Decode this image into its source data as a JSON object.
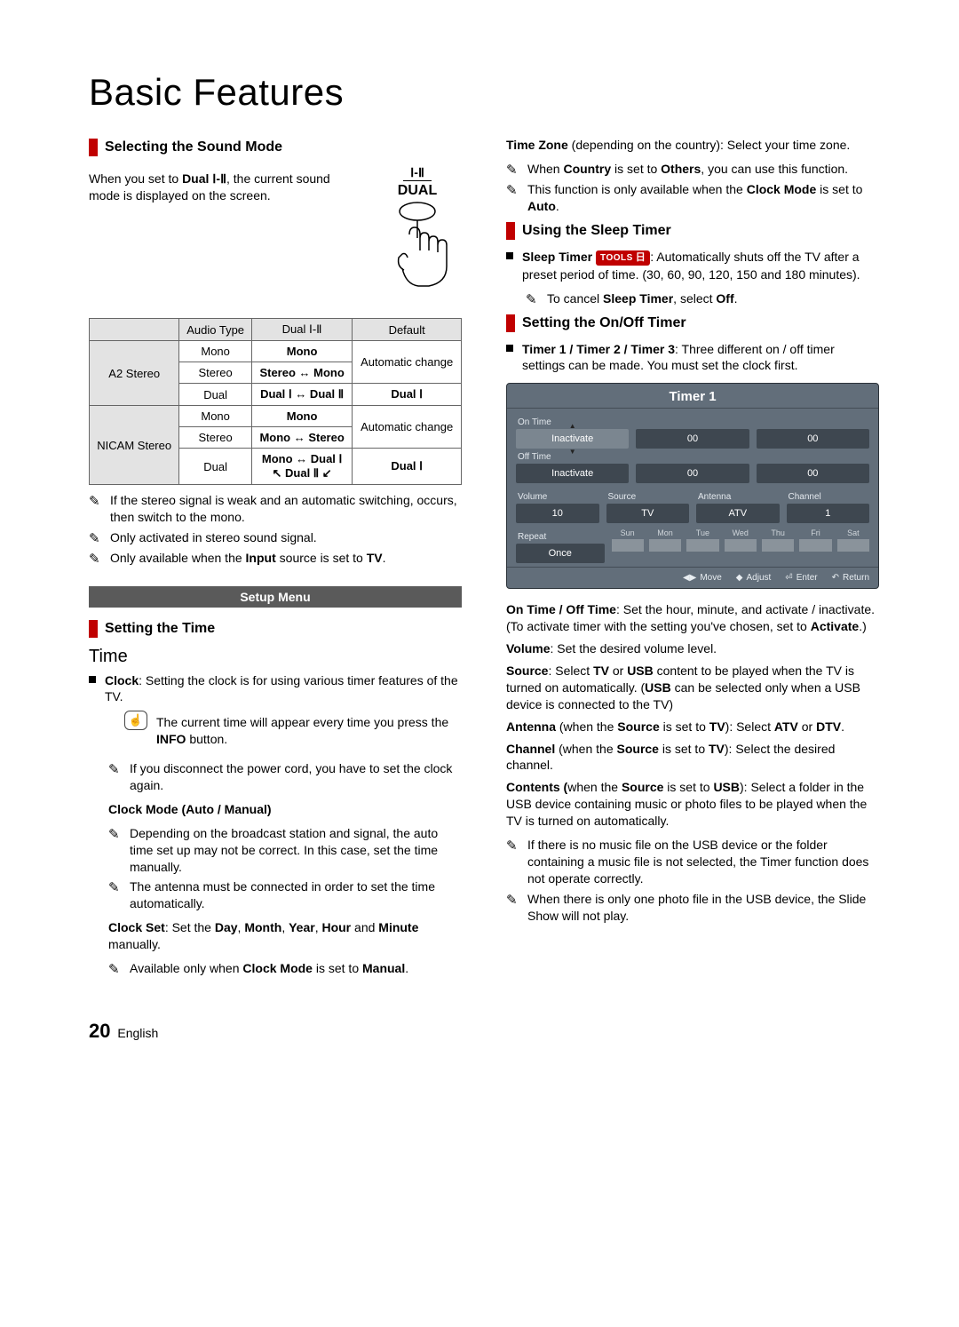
{
  "title": "Basic Features",
  "footer": {
    "pageNumber": "20",
    "lang": "English"
  },
  "leftCol": {
    "soundMode": {
      "heading": "Selecting the Sound Mode",
      "intro_before": "When you set to ",
      "intro_bold": "Dual Ⅰ-Ⅱ",
      "intro_after": ", the current sound mode is displayed on the screen.",
      "dualFig": {
        "line1": "Ⅰ-Ⅱ",
        "line2": "DUAL"
      },
      "table": {
        "headers": {
          "c1": "",
          "c2": "Audio Type",
          "c3": "Dual Ⅰ-Ⅱ",
          "c4": "Default"
        },
        "groups": [
          {
            "group": "A2 Stereo",
            "rows": [
              {
                "type": "Mono",
                "dual": "Mono",
                "default": "Automatic change",
                "dualBold": true
              },
              {
                "type": "Stereo",
                "dual": "Stereo ↔ Mono",
                "default": "",
                "dualBold": true
              },
              {
                "type": "Dual",
                "dual": "Dual Ⅰ ↔ Dual Ⅱ",
                "default": "Dual Ⅰ",
                "dualBold": true
              }
            ]
          },
          {
            "group": "NICAM Stereo",
            "rows": [
              {
                "type": "Mono",
                "dual": "Mono",
                "default": "Automatic change",
                "dualBold": true
              },
              {
                "type": "Stereo",
                "dual": "Mono ↔ Stereo",
                "default": "",
                "dualBold": true
              },
              {
                "type": "Dual",
                "dual": "Mono ↔ Dual Ⅰ\n↖ Dual Ⅱ ↙",
                "default": "Dual Ⅰ",
                "dualBold": true
              }
            ]
          }
        ]
      },
      "notes": [
        "If the stereo signal is weak and an automatic switching, occurs, then switch to the mono.",
        "Only activated in stereo sound signal.",
        {
          "pre": "Only available when the ",
          "b": "Input",
          "post": " source is set to ",
          "b2": "TV",
          "post2": "."
        }
      ]
    },
    "setupBand": "Setup Menu",
    "settingTime": {
      "heading": "Setting the Time"
    },
    "time": {
      "bigHeading": "Time",
      "clock": {
        "label": "Clock",
        "text": ": Setting the clock is for using various timer features of the TV.",
        "infoNote_before": "The current time will appear every time you press the ",
        "infoNote_bold": "INFO",
        "infoNote_after": " button.",
        "disconnectNote": "If you disconnect the power cord, you have to set the clock again.",
        "clockModeLabel": "Clock Mode (Auto / Manual)",
        "clockModeNotes": [
          "Depending on the broadcast station and signal, the auto time set up may not be correct. In this case, set the time manually.",
          "The antenna must be connected in order to set the time automatically."
        ],
        "clockSet_before": "Clock Set",
        "clockSet_after1": ": Set the ",
        "words": [
          "Day",
          "Month",
          "Year",
          "Hour",
          "Minute"
        ],
        "clockSet_tail": " manually.",
        "clockSetNote_before": "Available only when ",
        "clockSetNote_bold": "Clock Mode",
        "clockSetNote_mid": " is set to ",
        "clockSetNote_bold2": "Manual",
        "clockSetNote_after": "."
      }
    }
  },
  "rightCol": {
    "timeZone": {
      "lead_before": "Time Zone",
      "lead_after": " (depending on the country): Select your time zone.",
      "notes": [
        {
          "pre": "When ",
          "b": "Country",
          "mid": " is set to ",
          "b2": "Others",
          "post": ", you can use this function."
        },
        {
          "pre": "This function is only available when the ",
          "b": "Clock Mode",
          "mid": " is set to ",
          "b2": "Auto",
          "post": "."
        }
      ]
    },
    "sleepTimer": {
      "heading": "Using the Sleep Timer",
      "tools": "TOOLS",
      "lead_label": "Sleep Timer",
      "lead_text": ": Automatically shuts off the TV after a preset period of time. (30, 60, 90, 120, 150 and 180 minutes).",
      "note_before": "To cancel ",
      "note_bold": "Sleep Timer",
      "note_mid": ", select ",
      "note_bold2": "Off",
      "note_after": "."
    },
    "onOffTimer": {
      "heading": "Setting the On/Off Timer",
      "lead_label": "Timer 1 / Timer 2 / Timer 3",
      "lead_text": ": Three different on / off timer settings can be made. You must set the clock first.",
      "panel": {
        "title": "Timer 1",
        "onTimeLabel": "On Time",
        "onTime": {
          "activate": "Inactivate",
          "hh": "00",
          "mm": "00"
        },
        "offTimeLabel": "Off Time",
        "offTime": {
          "activate": "Inactivate",
          "hh": "00",
          "mm": "00"
        },
        "row3": {
          "volumeLabel": "Volume",
          "volume": "10",
          "sourceLabel": "Source",
          "source": "TV",
          "antennaLabel": "Antenna",
          "antenna": "ATV",
          "channelLabel": "Channel",
          "channel": "1"
        },
        "repeatLabel": "Repeat",
        "repeatValue": "Once",
        "days": [
          "Sun",
          "Mon",
          "Tue",
          "Wed",
          "Thu",
          "Fri",
          "Sat"
        ],
        "footer": {
          "move": "Move",
          "adjust": "Adjust",
          "enter": "Enter",
          "back": "Return"
        }
      },
      "desc": {
        "onoff_b": "On Time / Off Time",
        "onoff_t": ": Set the hour, minute, and activate / inactivate. (To activate timer with the setting you've chosen, set to ",
        "onoff_b2": "Activate",
        "onoff_t2": ".)",
        "vol_b": "Volume",
        "vol_t": ": Set the desired volume level.",
        "src_b": "Source",
        "src_t1": ": Select ",
        "src_b2": "TV",
        "src_t2": " or ",
        "src_b3": "USB",
        "src_t3": " content to be played when the TV is turned on automatically. (",
        "src_b4": "USB",
        "src_t4": " can be selected only when a USB device is connected to the TV)",
        "ant_b": "Antenna",
        "ant_t1": " (when the ",
        "ant_b2": "Source",
        "ant_t2": " is set to ",
        "ant_b3": "TV",
        "ant_t3": "): Select ",
        "ant_b4": "ATV",
        "ant_t4": " or ",
        "ant_b5": "DTV",
        "ant_t5": ".",
        "ch_b": "Channel",
        "ch_t1": " (when the ",
        "ch_b2": "Source",
        "ch_t2": " is set to ",
        "ch_b3": "TV",
        "ch_t3": "): Select the desired channel.",
        "con_b": "Contents (",
        "con_t1": "when the ",
        "con_b2": "Source",
        "con_t2": " is set to ",
        "con_b3": "USB",
        "con_t3": "): Select a folder in the USB device containing music or photo files to be played when the TV is turned on automatically.",
        "usbNotes": [
          "If there is no music file on the USB device or the folder containing a music file is not selected, the Timer function does not operate correctly.",
          "When there is only one photo file in the USB device, the Slide Show will not play."
        ]
      }
    }
  }
}
